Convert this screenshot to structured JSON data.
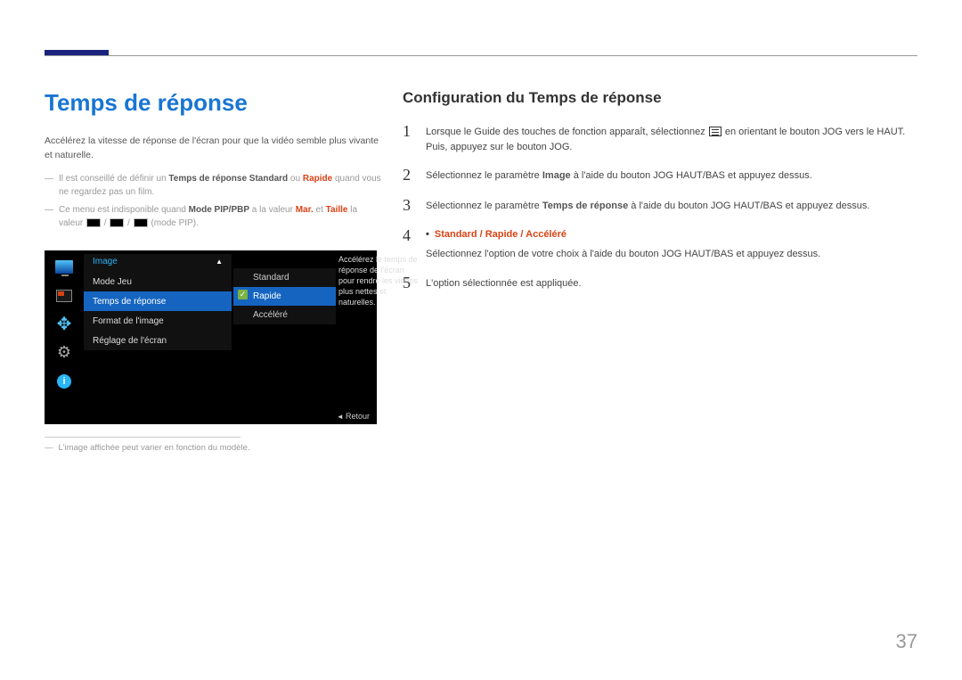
{
  "page_number": "37",
  "left": {
    "title": "Temps de réponse",
    "intro": "Accélérez la vitesse de réponse de l'écran pour que la vidéo semble plus vivante et naturelle.",
    "notes": [
      {
        "pre": "Il est conseillé de définir un ",
        "bold1": "Temps de réponse Standard",
        "mid": " ou ",
        "bold2": "Rapide",
        "post": " quand vous ne regardez pas un film."
      },
      {
        "pre": "Ce menu est indisponible quand ",
        "bold1": "Mode PIP/PBP",
        "mid": " a la valeur ",
        "bold2": "Mar.",
        "mid2": " et ",
        "bold3": "Taille",
        "post": " la valeur ",
        "tail": " (mode PIP)."
      }
    ],
    "footnote": "L'image affichée peut varier en fonction du modèle."
  },
  "osd": {
    "category": "Image",
    "menu": [
      "Mode Jeu",
      "Temps de réponse",
      "Format de l'image",
      "Réglage de l'écran"
    ],
    "menu_selected_index": 1,
    "options": [
      "Standard",
      "Rapide",
      "Accéléré"
    ],
    "option_selected_index": 1,
    "help": "Accélérez le temps de réponse de l'écran pour rendre les vidéos plus nettes et naturelles.",
    "back_label": "Retour"
  },
  "right": {
    "title": "Configuration du Temps de réponse",
    "steps": [
      {
        "n": "1",
        "segments": [
          {
            "t": "Lorsque le Guide des touches de fonction apparaît, sélectionnez "
          },
          {
            "icon": "menu"
          },
          {
            "t": " en orientant le bouton JOG vers le HAUT. Puis, appuyez sur le bouton JOG."
          }
        ]
      },
      {
        "n": "2",
        "segments": [
          {
            "t": "Sélectionnez le paramètre "
          },
          {
            "b": "Image"
          },
          {
            "t": " à l'aide du bouton JOG HAUT/BAS et appuyez dessus."
          }
        ]
      },
      {
        "n": "3",
        "segments": [
          {
            "t": "Sélectionnez le paramètre "
          },
          {
            "b": "Temps de réponse"
          },
          {
            "t": " à l'aide du bouton JOG HAUT/BAS et appuyez dessus."
          }
        ]
      },
      {
        "n": "4",
        "bullet": "Standard / Rapide / Accéléré",
        "segments": [
          {
            "t": "Sélectionnez l'option de votre choix à l'aide du bouton JOG HAUT/BAS et appuyez dessus."
          }
        ]
      },
      {
        "n": "5",
        "segments": [
          {
            "t": "L'option sélectionnée est appliquée."
          }
        ]
      }
    ]
  }
}
